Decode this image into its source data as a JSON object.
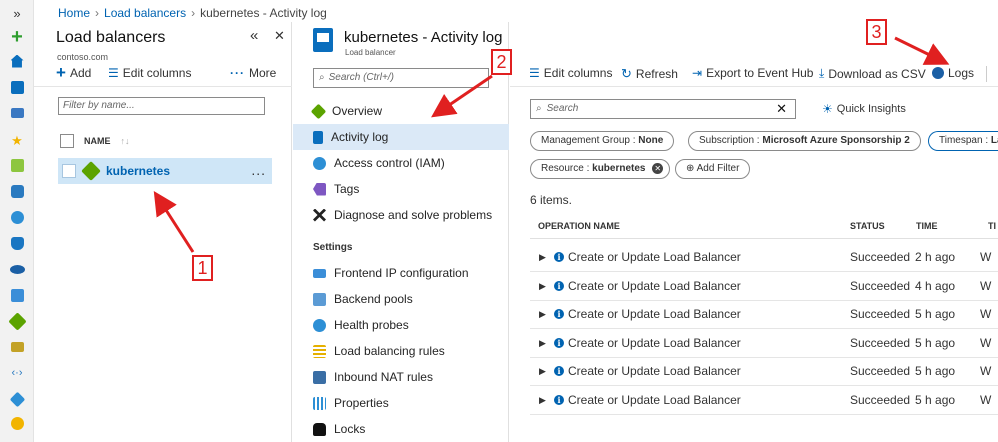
{
  "breadcrumb": {
    "home": "Home",
    "parent": "Load balancers",
    "current": "kubernetes - Activity log"
  },
  "rail": {
    "expand": "»"
  },
  "list_blade": {
    "title": "Load balancers",
    "subtitle": "contoso.com",
    "pin": "«",
    "close": "✕",
    "add": "Add",
    "edit_columns": "Edit columns",
    "more": "More",
    "filter_placeholder": "Filter by name...",
    "name_header": "NAME",
    "selected_item": "kubernetes",
    "row_menu": "..."
  },
  "resource_blade": {
    "title": "kubernetes - Activity log",
    "subtitle": "Load balancer",
    "search_placeholder": "Search (Ctrl+/)",
    "menu": [
      "Overview",
      "Activity log",
      "Access control (IAM)",
      "Tags",
      "Diagnose and solve problems"
    ],
    "settings_header": "Settings",
    "settings": [
      "Frontend IP configuration",
      "Backend pools",
      "Health probes",
      "Load balancing rules",
      "Inbound NAT rules",
      "Properties",
      "Locks"
    ]
  },
  "activity": {
    "toolbar": [
      "Edit columns",
      "Refresh",
      "Export to Event Hub",
      "Download as CSV",
      "Logs"
    ],
    "search_placeholder": "Search",
    "insights": "Quick Insights",
    "filters": {
      "mg_label": "Management Group : ",
      "mg_value": "None",
      "sub_label": "Subscription : ",
      "sub_value": "Microsoft Azure Sponsorship 2",
      "ts_label": "Timespan : ",
      "ts_value": "La",
      "res_label": "Resource : ",
      "res_value": "kubernetes"
    },
    "add_filter": "Add Filter",
    "count": "6 items.",
    "columns": [
      "OPERATION NAME",
      "STATUS",
      "TIME",
      "TI"
    ],
    "rows": [
      {
        "op": "Create or Update Load Balancer",
        "status": "Succeeded",
        "time": "2 h ago",
        "ts": "W"
      },
      {
        "op": "Create or Update Load Balancer",
        "status": "Succeeded",
        "time": "4 h ago",
        "ts": "W"
      },
      {
        "op": "Create or Update Load Balancer",
        "status": "Succeeded",
        "time": "5 h ago",
        "ts": "W"
      },
      {
        "op": "Create or Update Load Balancer",
        "status": "Succeeded",
        "time": "5 h ago",
        "ts": "W"
      },
      {
        "op": "Create or Update Load Balancer",
        "status": "Succeeded",
        "time": "5 h ago",
        "ts": "W"
      },
      {
        "op": "Create or Update Load Balancer",
        "status": "Succeeded",
        "time": "5 h ago",
        "ts": "W"
      }
    ]
  },
  "annotations": [
    "1",
    "2",
    "3"
  ],
  "colors": {
    "accent": "#0063b1",
    "selection": "#cfe6f7",
    "annotation": "#e02020"
  }
}
